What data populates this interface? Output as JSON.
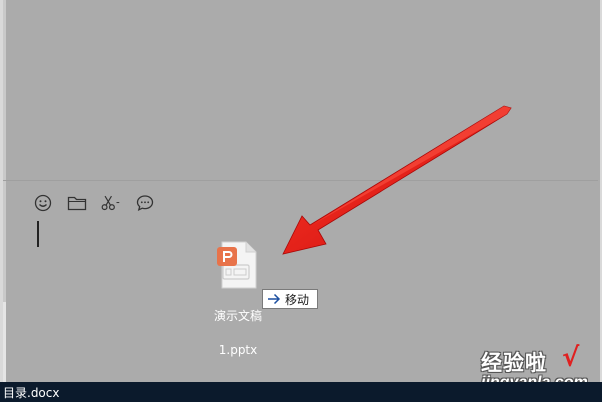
{
  "toolbar": {
    "buttons": [
      {
        "name": "emoji-icon"
      },
      {
        "name": "folder-icon"
      },
      {
        "name": "scissors-icon"
      },
      {
        "name": "chat-bubble-icon"
      }
    ]
  },
  "dragged_file": {
    "icon": "pptx-file-icon",
    "name_line1": "演示文稿",
    "name_line2": "1.pptx",
    "accent_color": "#e8734a"
  },
  "drag_tooltip": {
    "icon": "arrow-right-icon",
    "label": "移动"
  },
  "annotation": {
    "icon": "red-arrow-annotation",
    "color": "#e81010"
  },
  "watermark": {
    "text": "经验啦",
    "check": "√",
    "url": "jingyanla.com"
  },
  "taskbar": {
    "file_name": "目录.docx"
  }
}
